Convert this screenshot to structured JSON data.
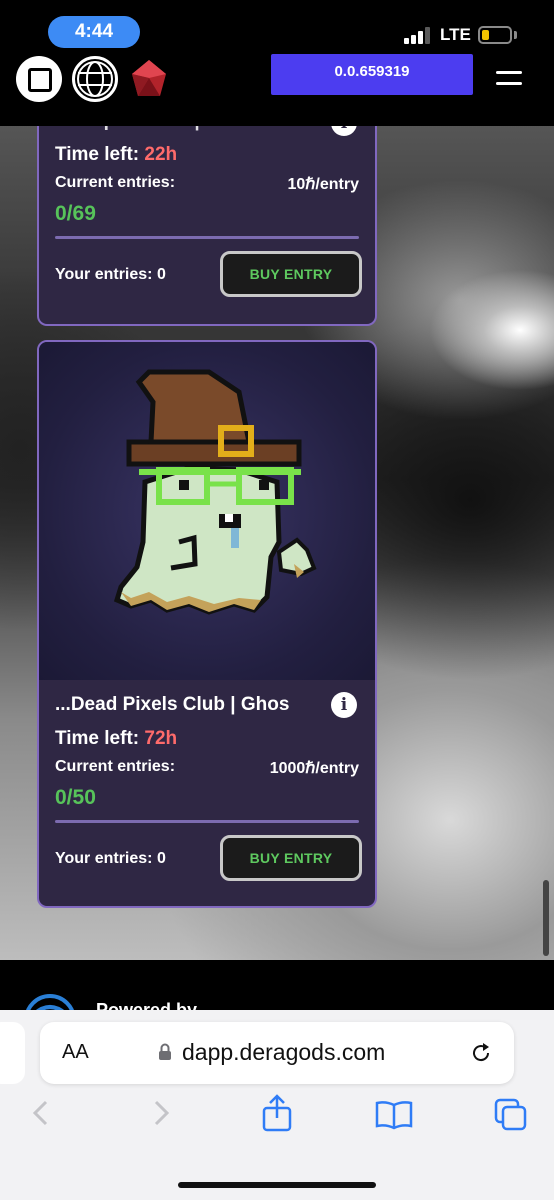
{
  "status_bar": {
    "time": "4:44",
    "network": "LTE"
  },
  "header": {
    "balance": "0.0.659319"
  },
  "cards": [
    {
      "title": "...Graph Punks | Witch",
      "time_label": "Time left:",
      "time_value": "22h",
      "entries_label": "Current entries:",
      "price": "10ℏ/entry",
      "count": "0/69",
      "your_entries": "Your entries: 0",
      "buy_label": "BUY ENTRY"
    },
    {
      "title": "...Dead Pixels Club | Ghos",
      "time_label": "Time left:",
      "time_value": "72h",
      "entries_label": "Current entries:",
      "price": "1000ℏ/entry",
      "count": "0/50",
      "your_entries": "Your entries: 0",
      "buy_label": "BUY ENTRY"
    }
  ],
  "footer": {
    "powered_by": "Powered by"
  },
  "browser": {
    "aa_label": "AA",
    "url": "dapp.deragods.com"
  },
  "colors": {
    "accent": "#4c3df0",
    "time_left": "#ff6b6b",
    "count": "#57c35a",
    "card_bg": "#2f2744",
    "card_border": "#8168c0"
  }
}
